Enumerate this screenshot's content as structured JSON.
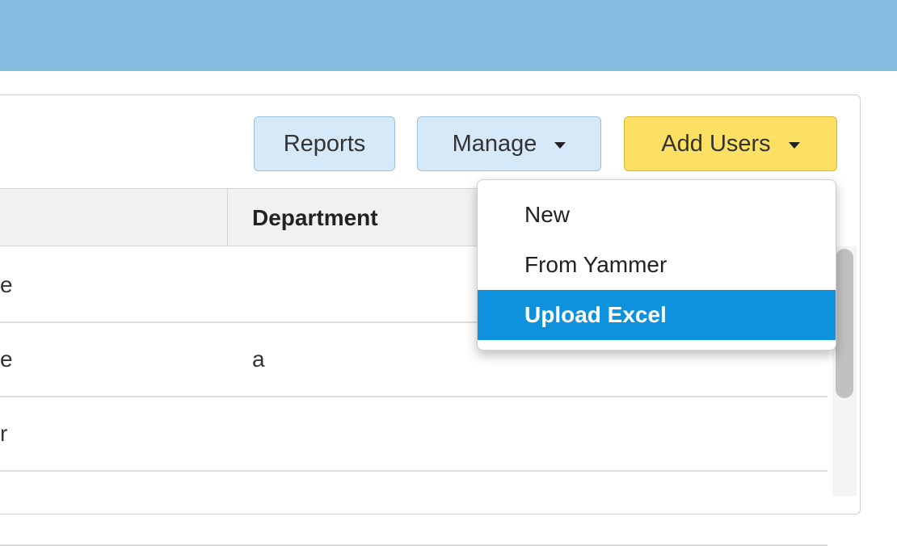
{
  "toolbar": {
    "reports_label": "Reports",
    "manage_label": "Manage",
    "add_users_label": "Add Users"
  },
  "table": {
    "header": "Department",
    "rows": [
      {
        "col1": "e",
        "col2": ""
      },
      {
        "col1": "e",
        "col2": "a"
      },
      {
        "col1": "r",
        "col2": ""
      }
    ]
  },
  "dropdown": {
    "items": [
      {
        "label": "New"
      },
      {
        "label": "From Yammer"
      },
      {
        "label": "Upload Excel"
      }
    ],
    "active_index": 2
  },
  "colors": {
    "top_bar": "#86bcdf",
    "primary_button": "#fbe064",
    "secondary_button": "#d6e9f8",
    "menu_highlight": "#0f92de"
  }
}
